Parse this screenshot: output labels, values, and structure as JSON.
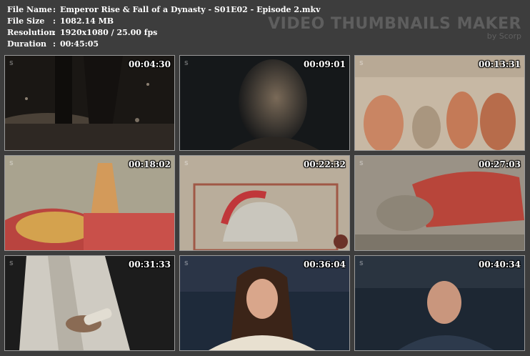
{
  "info": {
    "rows": [
      {
        "label": "File Name",
        "sep": ":",
        "value": "Emperor Rise & Fall of a Dynasty - S01E02 - Episode 2.mkv"
      },
      {
        "label": "File Size",
        "sep": ":",
        "value": "1082.14 MB"
      },
      {
        "label": "Resolution",
        "sep": ":",
        "value": "1920x1080 / 25.00 fps"
      },
      {
        "label": "Duration",
        "sep": ":",
        "value": "00:45:05"
      }
    ]
  },
  "brand": {
    "title": "VIDEO THUMBNAILS MAKER",
    "subtitle": "by Scorp"
  },
  "thumbnails": [
    {
      "timestamp": "00:04:30",
      "badge": "S",
      "scene": "dark-rain-legs"
    },
    {
      "timestamp": "00:09:01",
      "badge": "S",
      "scene": "old-man-portrait"
    },
    {
      "timestamp": "00:13:31",
      "badge": "S",
      "scene": "fresco-figures"
    },
    {
      "timestamp": "00:18:02",
      "badge": "S",
      "scene": "painted-reclining-figures"
    },
    {
      "timestamp": "00:22:32",
      "badge": "S",
      "scene": "mosaic-warrior-helmet"
    },
    {
      "timestamp": "00:27:03",
      "badge": "S",
      "scene": "mosaic-figure-red"
    },
    {
      "timestamp": "00:31:33",
      "badge": "S",
      "scene": "toga-scroll"
    },
    {
      "timestamp": "00:36:04",
      "badge": "S",
      "scene": "interview-woman"
    },
    {
      "timestamp": "00:40:34",
      "badge": "S",
      "scene": "interview-man"
    }
  ]
}
